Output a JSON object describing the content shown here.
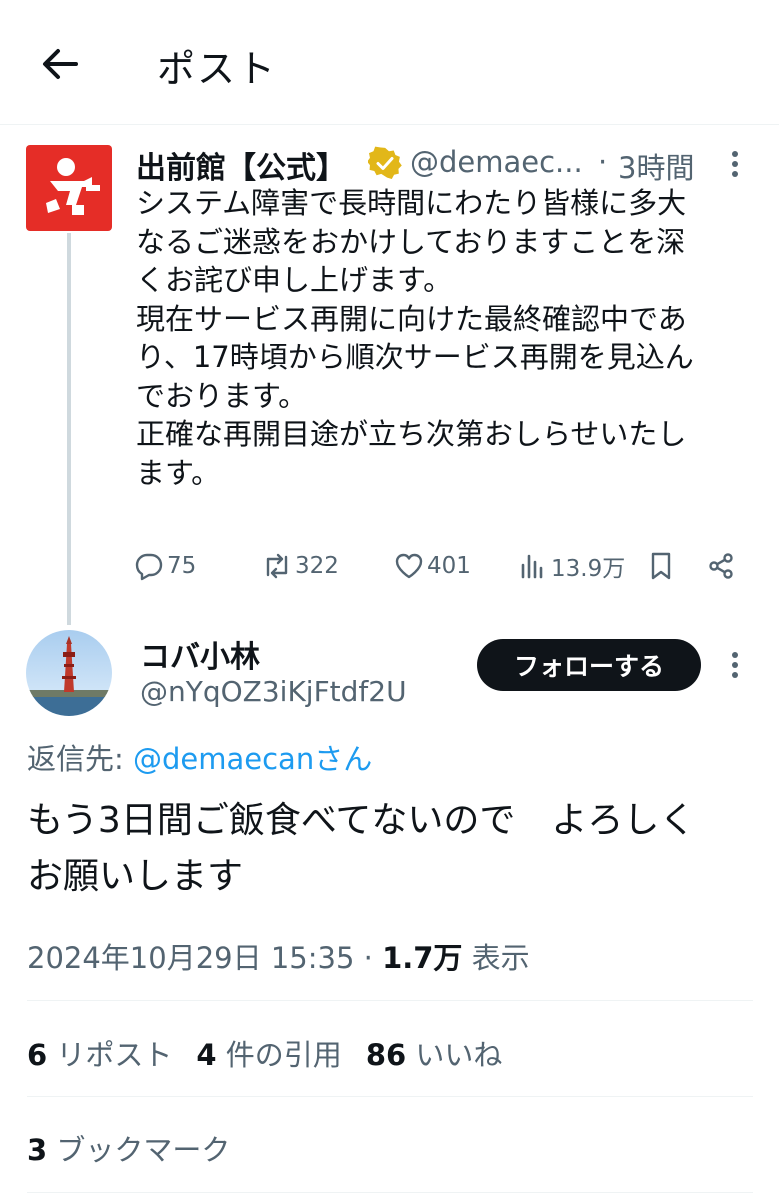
{
  "header": {
    "title": "ポスト",
    "back_icon": "arrow-left-icon"
  },
  "quoted_post": {
    "author_name": "出前館【公式】",
    "verified": true,
    "handle": "@demaec...",
    "separator": "·",
    "time": "3時間",
    "text": "システム障害で長時間にわたり皆様に多大\nなるご迷惑をおかけしておりますことを深\nくお詫び申し上げます。\n現在サービス再開に向けた最終確認中であ\nり、17時頃から順次サービス再開を見込ん\nでおります。\n正確な再開目途が立ち次第おしらせいたし\nます。",
    "actions": {
      "replies": "75",
      "reposts": "322",
      "likes": "401",
      "views": "13.9万"
    },
    "colors": {
      "avatar_bg": "#e52d27",
      "verified_badge": "#e2b719"
    }
  },
  "reply_post": {
    "author_name": "コバ小林",
    "handle": "@nYqOZ3iKjFtdf2U",
    "follow_label": "フォローする",
    "reply_to_prefix": "返信先: ",
    "reply_to_handle": "@demaecanさん",
    "text": "もう3日間ご飯食べてないので　よろしく\nお願いします",
    "timestamp": "2024年10月29日 15:35",
    "meta_separator": " · ",
    "views_count": "1.7万",
    "views_label": " 表示"
  },
  "stats": {
    "reposts_count": "6",
    "reposts_label": " リポスト",
    "quotes_count": "4",
    "quotes_label": " 件の引用",
    "likes_count": "86",
    "likes_label": " いいね",
    "bookmarks_count": "3",
    "bookmarks_label": " ブックマーク"
  },
  "colors": {
    "text": "#0f1419",
    "secondary": "#536471",
    "link": "#1d9bf0",
    "divider": "#eff3f4"
  }
}
